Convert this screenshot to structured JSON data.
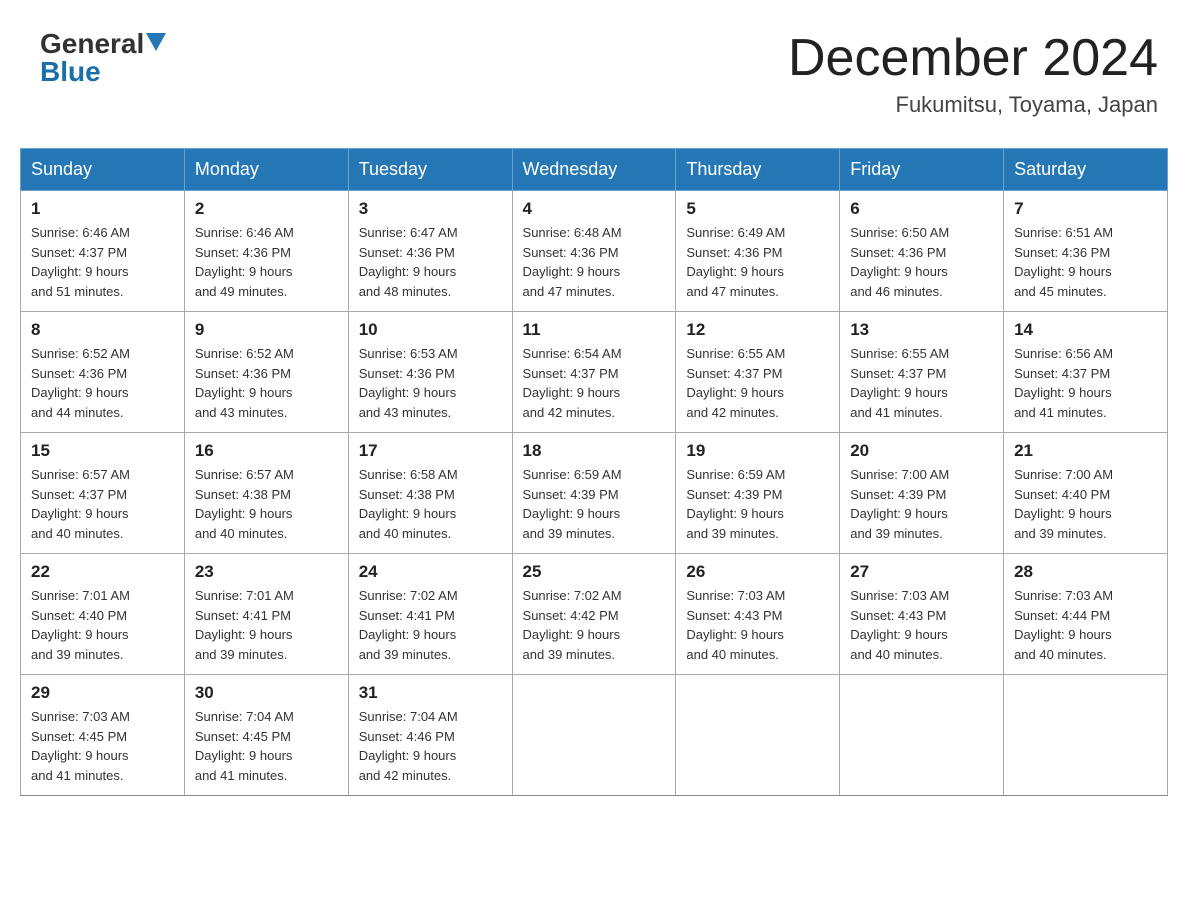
{
  "header": {
    "logo_general": "General",
    "logo_blue": "Blue",
    "title": "December 2024",
    "location": "Fukumitsu, Toyama, Japan"
  },
  "calendar": {
    "days_of_week": [
      "Sunday",
      "Monday",
      "Tuesday",
      "Wednesday",
      "Thursday",
      "Friday",
      "Saturday"
    ],
    "weeks": [
      [
        {
          "day": "1",
          "sunrise": "6:46 AM",
          "sunset": "4:37 PM",
          "daylight": "9 hours and 51 minutes."
        },
        {
          "day": "2",
          "sunrise": "6:46 AM",
          "sunset": "4:36 PM",
          "daylight": "9 hours and 49 minutes."
        },
        {
          "day": "3",
          "sunrise": "6:47 AM",
          "sunset": "4:36 PM",
          "daylight": "9 hours and 48 minutes."
        },
        {
          "day": "4",
          "sunrise": "6:48 AM",
          "sunset": "4:36 PM",
          "daylight": "9 hours and 47 minutes."
        },
        {
          "day": "5",
          "sunrise": "6:49 AM",
          "sunset": "4:36 PM",
          "daylight": "9 hours and 47 minutes."
        },
        {
          "day": "6",
          "sunrise": "6:50 AM",
          "sunset": "4:36 PM",
          "daylight": "9 hours and 46 minutes."
        },
        {
          "day": "7",
          "sunrise": "6:51 AM",
          "sunset": "4:36 PM",
          "daylight": "9 hours and 45 minutes."
        }
      ],
      [
        {
          "day": "8",
          "sunrise": "6:52 AM",
          "sunset": "4:36 PM",
          "daylight": "9 hours and 44 minutes."
        },
        {
          "day": "9",
          "sunrise": "6:52 AM",
          "sunset": "4:36 PM",
          "daylight": "9 hours and 43 minutes."
        },
        {
          "day": "10",
          "sunrise": "6:53 AM",
          "sunset": "4:36 PM",
          "daylight": "9 hours and 43 minutes."
        },
        {
          "day": "11",
          "sunrise": "6:54 AM",
          "sunset": "4:37 PM",
          "daylight": "9 hours and 42 minutes."
        },
        {
          "day": "12",
          "sunrise": "6:55 AM",
          "sunset": "4:37 PM",
          "daylight": "9 hours and 42 minutes."
        },
        {
          "day": "13",
          "sunrise": "6:55 AM",
          "sunset": "4:37 PM",
          "daylight": "9 hours and 41 minutes."
        },
        {
          "day": "14",
          "sunrise": "6:56 AM",
          "sunset": "4:37 PM",
          "daylight": "9 hours and 41 minutes."
        }
      ],
      [
        {
          "day": "15",
          "sunrise": "6:57 AM",
          "sunset": "4:37 PM",
          "daylight": "9 hours and 40 minutes."
        },
        {
          "day": "16",
          "sunrise": "6:57 AM",
          "sunset": "4:38 PM",
          "daylight": "9 hours and 40 minutes."
        },
        {
          "day": "17",
          "sunrise": "6:58 AM",
          "sunset": "4:38 PM",
          "daylight": "9 hours and 40 minutes."
        },
        {
          "day": "18",
          "sunrise": "6:59 AM",
          "sunset": "4:39 PM",
          "daylight": "9 hours and 39 minutes."
        },
        {
          "day": "19",
          "sunrise": "6:59 AM",
          "sunset": "4:39 PM",
          "daylight": "9 hours and 39 minutes."
        },
        {
          "day": "20",
          "sunrise": "7:00 AM",
          "sunset": "4:39 PM",
          "daylight": "9 hours and 39 minutes."
        },
        {
          "day": "21",
          "sunrise": "7:00 AM",
          "sunset": "4:40 PM",
          "daylight": "9 hours and 39 minutes."
        }
      ],
      [
        {
          "day": "22",
          "sunrise": "7:01 AM",
          "sunset": "4:40 PM",
          "daylight": "9 hours and 39 minutes."
        },
        {
          "day": "23",
          "sunrise": "7:01 AM",
          "sunset": "4:41 PM",
          "daylight": "9 hours and 39 minutes."
        },
        {
          "day": "24",
          "sunrise": "7:02 AM",
          "sunset": "4:41 PM",
          "daylight": "9 hours and 39 minutes."
        },
        {
          "day": "25",
          "sunrise": "7:02 AM",
          "sunset": "4:42 PM",
          "daylight": "9 hours and 39 minutes."
        },
        {
          "day": "26",
          "sunrise": "7:03 AM",
          "sunset": "4:43 PM",
          "daylight": "9 hours and 40 minutes."
        },
        {
          "day": "27",
          "sunrise": "7:03 AM",
          "sunset": "4:43 PM",
          "daylight": "9 hours and 40 minutes."
        },
        {
          "day": "28",
          "sunrise": "7:03 AM",
          "sunset": "4:44 PM",
          "daylight": "9 hours and 40 minutes."
        }
      ],
      [
        {
          "day": "29",
          "sunrise": "7:03 AM",
          "sunset": "4:45 PM",
          "daylight": "9 hours and 41 minutes."
        },
        {
          "day": "30",
          "sunrise": "7:04 AM",
          "sunset": "4:45 PM",
          "daylight": "9 hours and 41 minutes."
        },
        {
          "day": "31",
          "sunrise": "7:04 AM",
          "sunset": "4:46 PM",
          "daylight": "9 hours and 42 minutes."
        },
        null,
        null,
        null,
        null
      ]
    ]
  },
  "labels": {
    "sunrise_label": "Sunrise:",
    "sunset_label": "Sunset:",
    "daylight_label": "Daylight:"
  }
}
